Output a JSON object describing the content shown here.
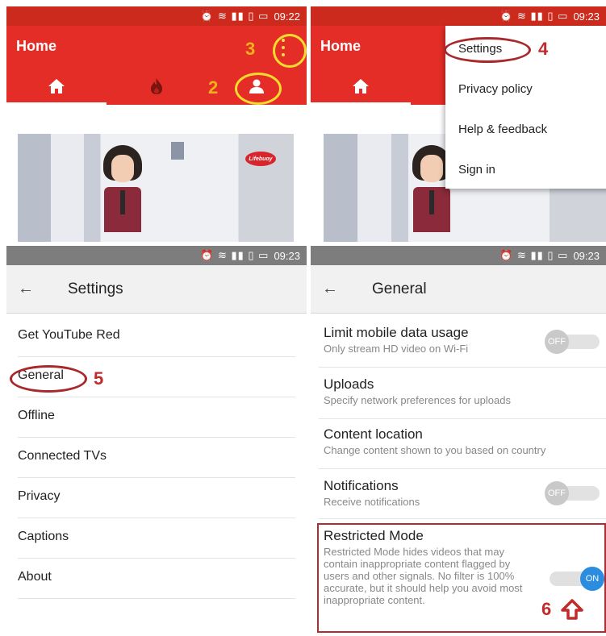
{
  "status_time_1": "09:22",
  "status_time_2": "09:23",
  "status_time_3": "09:23",
  "status_time_4": "09:23",
  "status_icons": "⏰ ≋ ▮▮ ▯ ▭",
  "home": {
    "title": "Home"
  },
  "thumbnail": {
    "logo_text": "Lifebuoy"
  },
  "overflow_menu": {
    "items": [
      "Settings",
      "Privacy policy",
      "Help & feedback",
      "Sign in"
    ]
  },
  "settings": {
    "title": "Settings",
    "items": [
      "Get YouTube Red",
      "General",
      "Offline",
      "Connected TVs",
      "Privacy",
      "Captions",
      "About"
    ]
  },
  "general": {
    "title": "General",
    "prefs": [
      {
        "title": "Limit mobile data usage",
        "subtitle": "Only stream HD video on Wi-Fi",
        "toggle": "OFF"
      },
      {
        "title": "Uploads",
        "subtitle": "Specify network preferences for uploads"
      },
      {
        "title": "Content location",
        "subtitle": "Change content shown to you based on country"
      },
      {
        "title": "Notifications",
        "subtitle": "Receive notifications",
        "toggle": "OFF"
      },
      {
        "title": "Restricted Mode",
        "subtitle": "Restricted Mode hides videos that may contain inappropriate content flagged by users and other signals. No filter is 100% accurate, but it should help you avoid most inappropriate content.",
        "toggle": "ON"
      }
    ]
  },
  "annotations": {
    "a2": "2",
    "a3": "3",
    "a4": "4",
    "a5": "5",
    "a6": "6"
  },
  "colors": {
    "youtube_red": "#e52d27",
    "status_red": "#cc2a1d",
    "annotation_yellow": "#f4dc2e",
    "annotation_red": "#a8282b",
    "toggle_on": "#2c8ce0"
  }
}
